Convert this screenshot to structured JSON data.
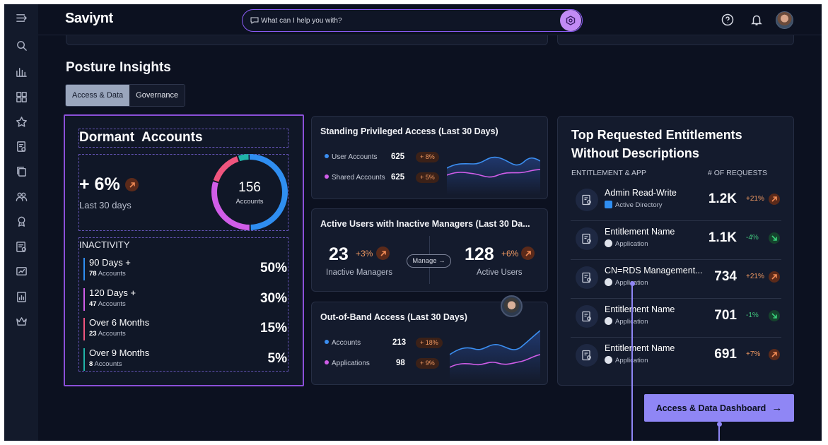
{
  "app": {
    "logo": "Saviynt"
  },
  "search": {
    "placeholder": "What can I help you with?"
  },
  "page": {
    "title": "Posture Insights"
  },
  "tabs": [
    {
      "label": "Access & Data",
      "active": true
    },
    {
      "label": "Governance",
      "active": false
    }
  ],
  "dormant": {
    "title": "Dormant  Accounts",
    "change": "+ 6%",
    "period": "Last 30 days",
    "total": "156",
    "total_label": "Accounts",
    "inactivity_title": "INACTIVITY",
    "rows": [
      {
        "label": "90 Days +",
        "count": "78",
        "unit": "Accounts",
        "pct": "50%",
        "color": "#2f8ef1"
      },
      {
        "label": "120 Days +",
        "count": "47",
        "unit": "Accounts",
        "pct": "30%",
        "color": "#d05de8"
      },
      {
        "label": "Over 6 Months",
        "count": "23",
        "unit": "Accounts",
        "pct": "15%",
        "color": "#f0557e"
      },
      {
        "label": "Over 9 Months",
        "count": "8",
        "unit": "Accounts",
        "pct": "5%",
        "color": "#20b4a8"
      }
    ]
  },
  "standing": {
    "title": "Standing Privileged Access (Last 30 Days)",
    "items": [
      {
        "label": "User Accounts",
        "value": "625",
        "change": "+ 8%",
        "color": "#3b8ef0"
      },
      {
        "label": "Shared Accounts",
        "value": "625",
        "change": "+ 5%",
        "color": "#d05de8"
      }
    ]
  },
  "managers": {
    "title": "Active Users with Inactive Managers (Last 30 Da...",
    "left": {
      "value": "23",
      "change": "+3%",
      "caption": "Inactive Managers"
    },
    "right": {
      "value": "128",
      "change": "+6%",
      "caption": "Active Users"
    },
    "manage_label": "Manage"
  },
  "outofband": {
    "title": "Out-of-Band Access (Last 30 Days)",
    "items": [
      {
        "label": "Accounts",
        "value": "213",
        "change": "+ 18%",
        "color": "#3b8ef0"
      },
      {
        "label": "Applications",
        "value": "98",
        "change": "+ 9%",
        "color": "#d05de8"
      }
    ]
  },
  "entitlements": {
    "title": "Top Requested Entitlements Without Descriptions",
    "col_left": "ENTITLEMENT & APP",
    "col_right": "# OF REQUESTS",
    "rows": [
      {
        "name": "Admin Read-Write",
        "app": "Active Directory",
        "count": "1.2K",
        "change": "+21%",
        "direction": "up"
      },
      {
        "name": "Entitlement Name",
        "app": "Application",
        "count": "1.1K",
        "change": "-4%",
        "direction": "down"
      },
      {
        "name": "CN=RDS Management...",
        "app": "Application",
        "count": "734",
        "change": "+21%",
        "direction": "up"
      },
      {
        "name": "Entitlement Name",
        "app": "Application",
        "count": "701",
        "change": "-1%",
        "direction": "down"
      },
      {
        "name": "Entitlement Name",
        "app": "Application",
        "count": "691",
        "change": "+7%",
        "direction": "up"
      }
    ]
  },
  "dashboard_button": {
    "label": "Access & Data Dashboard"
  },
  "colors": {
    "accent": "#8f86f5",
    "purple_border": "#8b4fd8",
    "background": "#0c1120",
    "up": "#f29a62",
    "down": "#42c97f"
  }
}
